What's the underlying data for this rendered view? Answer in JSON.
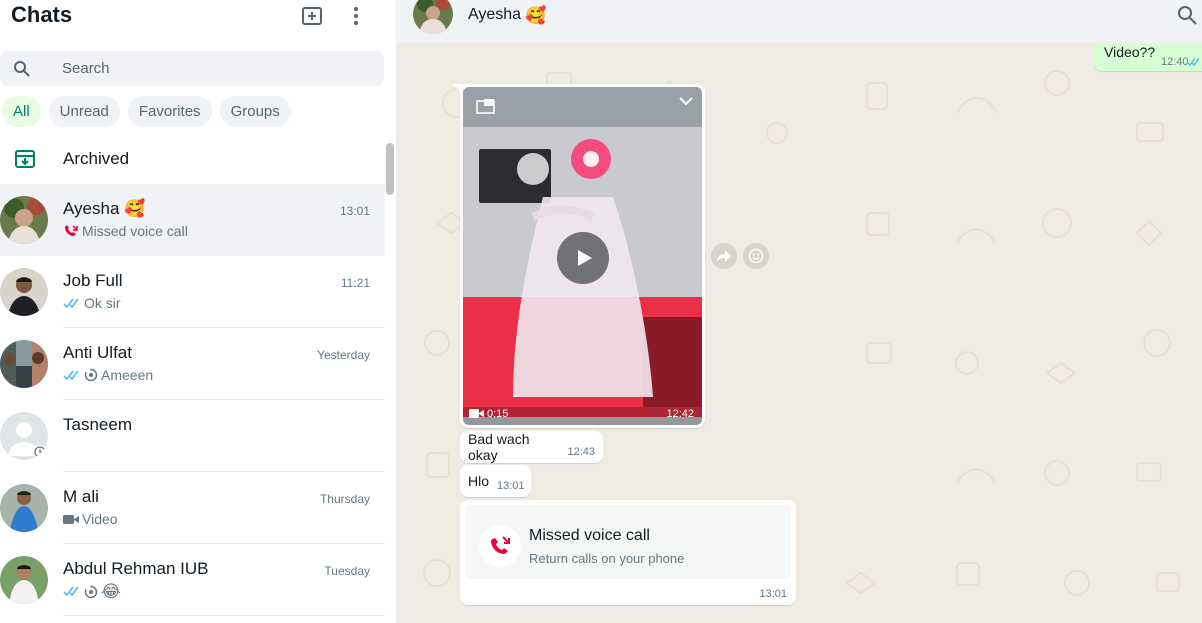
{
  "sidebar": {
    "title": "Chats",
    "new_chat_icon": "new-chat-icon",
    "menu_icon": "menu-dots-icon",
    "search": {
      "placeholder": "Search",
      "value": ""
    },
    "filters": [
      {
        "label": "All",
        "active": true
      },
      {
        "label": "Unread",
        "active": false
      },
      {
        "label": "Favorites",
        "active": false
      },
      {
        "label": "Groups",
        "active": false
      }
    ],
    "archived_label": "Archived",
    "chats": [
      {
        "name": "Ayesha 🥰",
        "time": "13:01",
        "preview": "Missed voice call",
        "status_icon": "missed-call-icon",
        "selected": true
      },
      {
        "name": "Job Full",
        "time": "11:21",
        "preview": "Ok sir",
        "status_icon": "double-tick-icon",
        "selected": false
      },
      {
        "name": "Anti Ulfat",
        "time": "Yesterday",
        "preview": "Ameeen",
        "status_icon": "double-tick-icon",
        "selected": false
      },
      {
        "name": "Tasneem",
        "time": "",
        "preview": "",
        "status_icon": "",
        "selected": false
      },
      {
        "name": "M ali",
        "time": "Thursday",
        "preview": "Video",
        "status_icon": "video-icon",
        "selected": false
      },
      {
        "name": "Abdul Rehman IUB",
        "time": "Tuesday",
        "preview": "😂",
        "status_icon": "double-tick-icon",
        "selected": false
      }
    ]
  },
  "conversation": {
    "contact_name": "Ayesha",
    "contact_emoji": "🥰",
    "messages": {
      "outgoing": {
        "text": "Video??",
        "time": "12:40"
      },
      "video": {
        "duration": "0:15",
        "time": "12:42"
      },
      "bad_wach": {
        "text": "Bad wach okay",
        "time": "12:43"
      },
      "hlo": {
        "text": "Hlo",
        "time": "13:01"
      },
      "call": {
        "title": "Missed voice call",
        "subtitle": "Return calls on your phone",
        "time": "13:01"
      }
    }
  },
  "colors": {
    "accent": "#008069",
    "outgoing_bubble": "#d9fdd3",
    "chat_background": "#efeae2",
    "tick_blue": "#53bdeb",
    "missed_call_red": "#ea0038"
  }
}
